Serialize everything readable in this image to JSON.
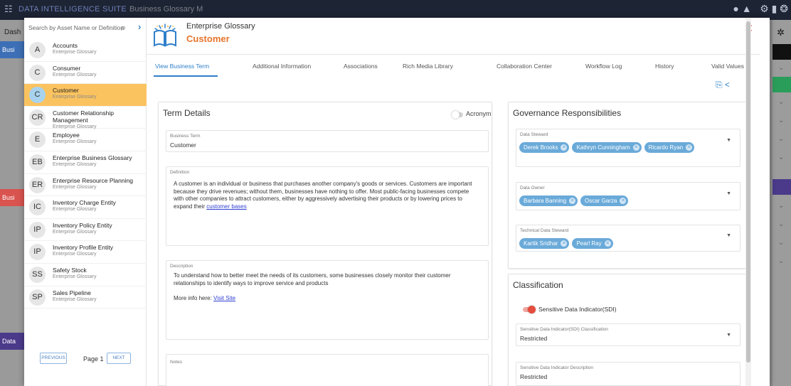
{
  "background": {
    "brand": "DATA INTELLIGENCE SUITE",
    "crumb": "Business Glossary M",
    "dash": "Dash",
    "tags": [
      "Busi",
      "Busi",
      "Data"
    ]
  },
  "left_pane": {
    "search_placeholder": "Search by Asset Name or Definition",
    "items": [
      {
        "initials": "A",
        "name": "Accounts",
        "sub": "Enterprise Glossary",
        "selected": false
      },
      {
        "initials": "C",
        "name": "Consumer",
        "sub": "Enterprise Glossary",
        "selected": false
      },
      {
        "initials": "C",
        "name": "Customer",
        "sub": "Enterprise Glossary",
        "selected": true
      },
      {
        "initials": "CR",
        "name": "Customer Relationship Management",
        "sub": "Enterprise Glossary",
        "selected": false
      },
      {
        "initials": "E",
        "name": "Employee",
        "sub": "Enterprise Glossary",
        "selected": false
      },
      {
        "initials": "EB",
        "name": "Enterprise Business Glossary",
        "sub": "Enterprise Glossary",
        "selected": false
      },
      {
        "initials": "ER",
        "name": "Enterprise Resource Planning",
        "sub": "Enterprise Glossary",
        "selected": false
      },
      {
        "initials": "IC",
        "name": "Inventory Charge Entity",
        "sub": "Enterprise Glossary",
        "selected": false
      },
      {
        "initials": "IP",
        "name": "Inventory Policy Entity",
        "sub": "Enterprise Glossary",
        "selected": false
      },
      {
        "initials": "IP",
        "name": "Inventory Profile Entity",
        "sub": "Enterprise Glossary",
        "selected": false
      },
      {
        "initials": "SS",
        "name": "Safety Stock",
        "sub": "Enterprise Glossary",
        "selected": false
      },
      {
        "initials": "SP",
        "name": "Sales Pipeline",
        "sub": "Enterprise Glossary",
        "selected": false
      }
    ],
    "pager": {
      "previous": "PREVIOUS",
      "page_label": "Page 1",
      "next": "NEXT"
    }
  },
  "header": {
    "glossary": "Enterprise Glossary",
    "title": "Customer"
  },
  "tabs": [
    "View Business Term",
    "Additional Information",
    "Associations",
    "Rich Media Library",
    "Collaboration Center",
    "Workflow Log",
    "History",
    "Valid Values"
  ],
  "term_details": {
    "title": "Term Details",
    "acronym_label": "Acronym",
    "business_term_label": "Business Term",
    "business_term_value": "Customer",
    "definition_label": "Definition",
    "definition_text": "A customer is an individual or business that purchases another company's goods or services. Customers are important because they drive revenues; without them, businesses have nothing to offer. Most public-facing businesses compete with other companies to attract customers, either by aggressively advertising their products or by lowering prices to expand their",
    "definition_link": "customer bases",
    "description_label": "Description",
    "description_text": "To understand how to better meet the needs of its customers, some businesses closely monitor their customer relationships to identify ways to improve service and products",
    "more_info_label": "More info here:",
    "more_info_link": "Visit Site",
    "notes_label": "Notes"
  },
  "governance": {
    "title": "Governance Responsibilities",
    "data_steward_label": "Data Steward",
    "data_stewards": [
      "Derek Brooks",
      "Kathryn Cunningham",
      "Ricardo Ryan"
    ],
    "data_owner_label": "Data Owner",
    "data_owners": [
      "Barbara Banning",
      "Oscar Garza"
    ],
    "tech_steward_label": "Technical Data Steward",
    "tech_stewards": [
      "Kartik Sridhar",
      "Pearl Ray"
    ]
  },
  "classification": {
    "title": "Classification",
    "sdi_label": "Sensitive Data Indicator(SDI)",
    "sdi_class_label": "Sensitive Data Indicator(SDI) Classification",
    "sdi_class_value": "Restricted",
    "sdi_desc_label": "Sensitive Data Indicator Description",
    "sdi_desc_value": "Restricted"
  },
  "colors": {
    "accent": "#2f7fc9",
    "title_orange": "#e8742c",
    "selected": "#fbc35f",
    "chip": "#6aaad9",
    "close": "#e23c2f"
  }
}
